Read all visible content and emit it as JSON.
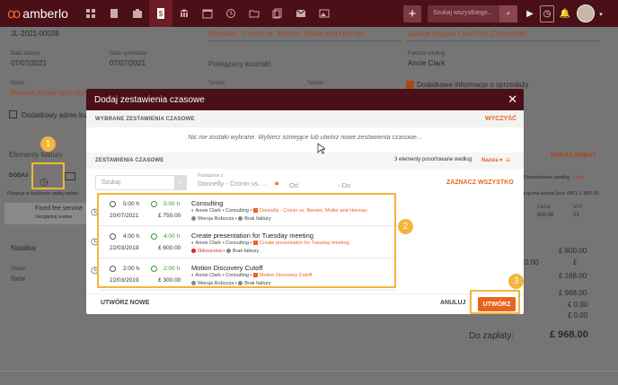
{
  "app": {
    "logo": "amberlo",
    "search_placeholder": "Szukaj wszystkiego..."
  },
  "background": {
    "invoice_number": "JL-2021-00038",
    "client_top": "Donnelly - Cronin vs. Bernier, Muller and Herman",
    "client_top_right": "Justice League Law Firm (Domyślne)",
    "label_date_invoice": "Data faktury",
    "date_invoice": "07/07/2021",
    "label_date_sale": "Data sprzedaży",
    "date_sale": "07/07/2021",
    "linked_contract": "Powiązany kontrakt",
    "label_invoice_by": "Faktura według",
    "invoice_by": "Annie Clark",
    "label_client": "Klient",
    "client": "Bernier, Muller and Herman",
    "label_t1": "Termin",
    "label_t2": "Termin",
    "extra_info": "Dodatkowe informacje o sprzedaży",
    "extra_address": "Dodatkowy adres kup",
    "items_title": "Elementy faktury",
    "add_label": "DODAJ",
    "show_discount": "POKAŻ RABAT",
    "sort_label": "Posortowane według",
    "sort_value": "Data",
    "position_label": "Pozycja w budżecie stałej opłaty",
    "net_label": "Łączna kwota (bez VAT): £ 800.00",
    "fixed_fee": "Fixed fee service",
    "fixed_fee_sub": "Uwzględnij zestaw",
    "price_label": "Cena",
    "price_val": "800.00",
    "vat_label": "VAT",
    "vat_val": "21",
    "note_label": "Notatka",
    "status_label": "Status",
    "status_val": "New",
    "sum1": "£ 800.00",
    "sum2": "0.00",
    "sum2b": "£",
    "sum3": "£ 168.00",
    "sum4": "£ 968.00",
    "sum5": "£ 0.00",
    "sum6": "£ 0.00",
    "to_pay_label": "Do zapłaty:",
    "to_pay": "£ 968.00"
  },
  "modal": {
    "title": "Dodaj zestawienia czasowe",
    "selected_header": "WYBRANE ZESTAWIENIA CZASOWE",
    "clear_label": "WYCZYŚĆ",
    "empty_text": "Nic nie zostało wybrane. Wybierz istniejące lub utwórz nowe zestawienia czasowe...",
    "list_header": "ZESTAWIENIA CZASOWE",
    "count_text": "3 elementy posortowane według",
    "sort_value": "Nazwa",
    "search_placeholder": "Szukaj",
    "project_label": "Powiązane z",
    "project_value": "Donnelly - Cronin vs. ...",
    "from_label": "Od",
    "to_label": "Do",
    "select_all": "ZAZNACZ WSZYSTKO",
    "new_button": "UTWÓRZ NOWE",
    "cancel_button": "ANULUJ",
    "create_button": "UTWÓRZ",
    "entries": [
      {
        "time": "5:00 h",
        "date": "20/07/2021",
        "billable": "5:00 h",
        "amount": "£ 750.00",
        "name": "Consulting",
        "user": "Annie Clark",
        "activity": "Consulting",
        "project": "Donnelly - Cronin vs. Bernier, Muller and Herman",
        "assignee": "Wersja Robocza",
        "invoice": "Brak faktury"
      },
      {
        "time": "4:00 h",
        "date": "22/03/2019",
        "billable": "4:00 h",
        "amount": "£ 600.00",
        "name": "Create presentation for Tuesday meeting",
        "user": "Annie Clark",
        "activity": "Consulting",
        "project": "Create presentation for Tuesday meeting",
        "assignee": "Odrzucona",
        "invoice": "Brak faktury"
      },
      {
        "time": "2:00 h",
        "date": "22/03/2019",
        "billable": "2:00 h",
        "amount": "£ 300.00",
        "name": "Motion Discovery Cutoff",
        "user": "Annie Clark",
        "activity": "Consulting",
        "project": "Motion Discovery Cutoff",
        "assignee": "Wersja Robocza",
        "invoice": "Brak faktury"
      }
    ]
  },
  "callouts": {
    "one": "1",
    "two": "2",
    "three": "3"
  },
  "colors": {
    "brand": "#4a0f17",
    "accent": "#e8641f",
    "highlight": "#f3b53a"
  }
}
